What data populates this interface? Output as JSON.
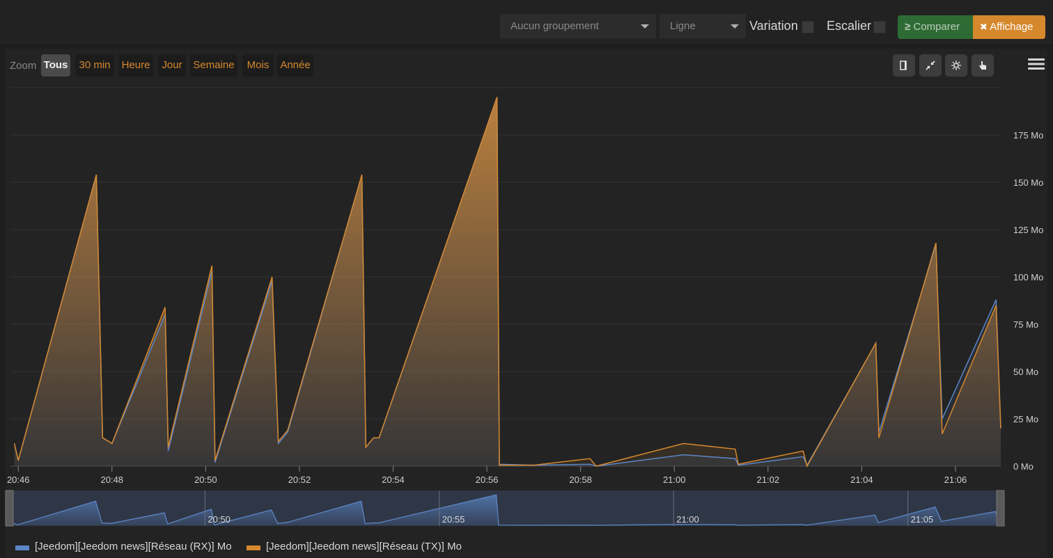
{
  "toolbar": {
    "grouping": "Aucun groupement",
    "type": "Ligne",
    "variation_label": "Variation",
    "stair_label": "Escalier",
    "compare_label": "Comparer",
    "compare_icon": "≥",
    "display_label": "Affichage",
    "display_icon": "✖"
  },
  "zoom": {
    "label": "Zoom",
    "buttons": [
      "Tous",
      "30 min",
      "Heure",
      "Jour",
      "Semaine",
      "Mois",
      "Année"
    ],
    "active": "Tous"
  },
  "tools": [
    "column-icon",
    "shrink-icon",
    "sun-icon",
    "pointer-icon"
  ],
  "menu_icon": "hamburger-icon",
  "chart_data": {
    "type": "area",
    "title": "",
    "xlabel": "",
    "ylabel": "",
    "x_unit": "time (HH:MM)",
    "xlim": [
      "20:45:50",
      "21:06:58"
    ],
    "ylim": [
      0,
      200
    ],
    "x_ticks": [
      "20:46",
      "20:48",
      "20:50",
      "20:52",
      "20:54",
      "20:56",
      "20:58",
      "21:00",
      "21:02",
      "21:04",
      "21:06"
    ],
    "y_ticks": [
      "0 Mo",
      "25 Mo",
      "50 Mo",
      "75 Mo",
      "100 Mo",
      "125 Mo",
      "150 Mo",
      "175 Mo"
    ],
    "y_tick_values": [
      0,
      25,
      50,
      75,
      100,
      125,
      150,
      175
    ],
    "navigator_ticks": [
      "20:50",
      "20:55",
      "21:00",
      "21:05"
    ],
    "grid": true,
    "legend_position": "bottom-left",
    "colors": {
      "rx": "#5b86c5",
      "tx": "#d6882d"
    },
    "series": [
      {
        "name": "[Jeedom][Jeedom news][Réseau (RX)] Mo",
        "color": "#5b86c5",
        "x": [
          "20:45:55",
          "20:46:00",
          "20:47:40",
          "20:47:48",
          "20:48:00",
          "20:49:08",
          "20:49:12",
          "20:50:08",
          "20:50:12",
          "20:51:25",
          "20:51:33",
          "20:51:45",
          "20:53:20",
          "20:53:25",
          "20:53:35",
          "20:53:42",
          "20:56:13",
          "20:56:16",
          "20:57:00",
          "20:58:12",
          "20:58:20",
          "21:00:12",
          "21:01:18",
          "21:01:22",
          "21:02:45",
          "21:02:50",
          "21:04:18",
          "21:04:22",
          "21:05:35",
          "21:05:43",
          "21:06:52",
          "21:06:58"
        ],
        "y": [
          12,
          3,
          154,
          15,
          12,
          80,
          8,
          103,
          2,
          98,
          12,
          18,
          154,
          10,
          15,
          15,
          195,
          1,
          0.5,
          1,
          0,
          6,
          4,
          0.5,
          5,
          0.5,
          65,
          18,
          117,
          25,
          88,
          20
        ]
      },
      {
        "name": "[Jeedom][Jeedom news][Réseau (TX)] Mo",
        "color": "#d6882d",
        "x": [
          "20:45:55",
          "20:46:00",
          "20:47:40",
          "20:47:48",
          "20:48:00",
          "20:49:08",
          "20:49:12",
          "20:50:08",
          "20:50:12",
          "20:51:25",
          "20:51:33",
          "20:51:45",
          "20:53:20",
          "20:53:25",
          "20:53:35",
          "20:53:42",
          "20:56:13",
          "20:56:16",
          "20:57:00",
          "20:58:12",
          "20:58:20",
          "21:00:12",
          "21:01:18",
          "21:01:22",
          "21:02:45",
          "21:02:50",
          "21:04:18",
          "21:04:22",
          "21:05:35",
          "21:05:43",
          "21:06:52",
          "21:06:58"
        ],
        "y": [
          12,
          3,
          154,
          15,
          12,
          84,
          10,
          106,
          3,
          100,
          13,
          19,
          154,
          10,
          15,
          15,
          195,
          0.5,
          0.5,
          4,
          0,
          12,
          9,
          1,
          8,
          0,
          65,
          15,
          118,
          17,
          85,
          20
        ]
      }
    ]
  }
}
